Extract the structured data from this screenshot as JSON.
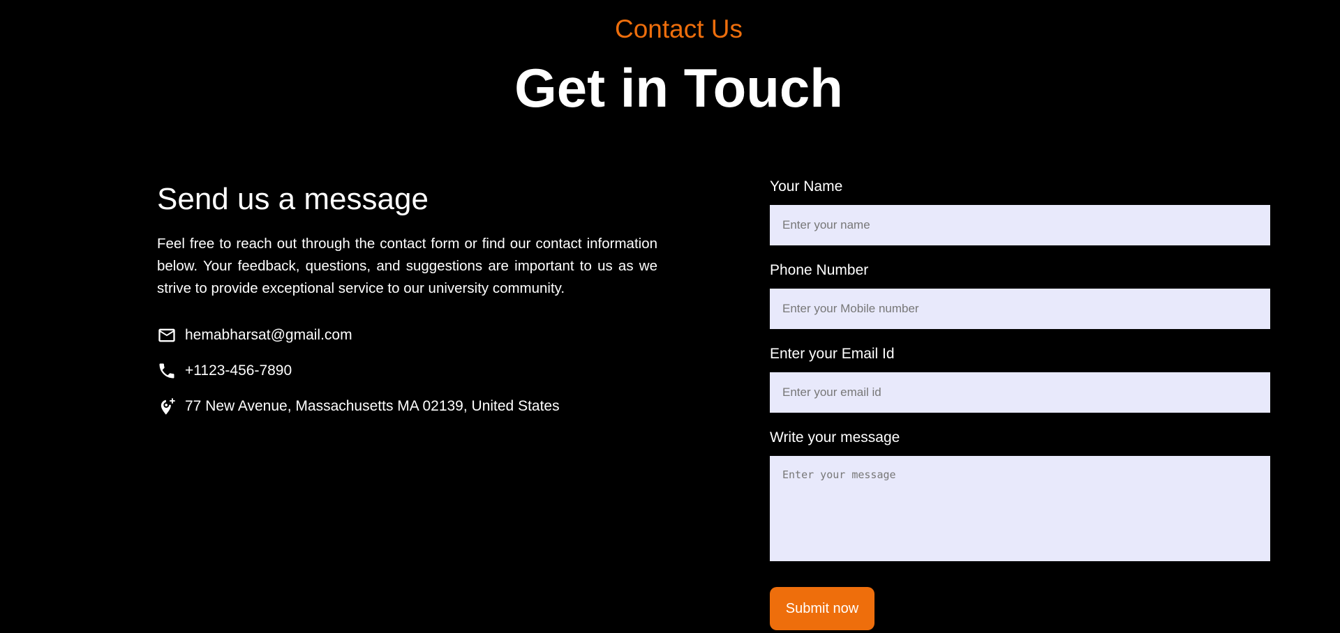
{
  "header": {
    "eyebrow": "Contact Us",
    "title": "Get in Touch"
  },
  "info": {
    "heading": "Send us a message",
    "description": "Feel free to reach out through the contact form or find our contact information below. Your feedback, questions, and suggestions are important to us as we strive to provide exceptional service to our university community.",
    "email": "hemabharsat@gmail.com",
    "phone": "+1123-456-7890",
    "address": "77 New Avenue, Massachusetts MA 02139, United States",
    "icons": [
      "mail-icon",
      "phone-icon",
      "location-add-icon"
    ]
  },
  "form": {
    "name_label": "Your Name",
    "name_placeholder": "Enter your name",
    "phone_label": "Phone Number",
    "phone_placeholder": "Enter your Mobile number",
    "email_label": "Enter your Email Id",
    "email_placeholder": "Enter your email id",
    "message_label": "Write your message",
    "message_placeholder": "Enter your message",
    "submit_label": "Submit now"
  },
  "colors": {
    "background": "#000000",
    "accent": "#ee6e0c",
    "input_bg": "#e8e9fb",
    "text": "#ffffff"
  }
}
